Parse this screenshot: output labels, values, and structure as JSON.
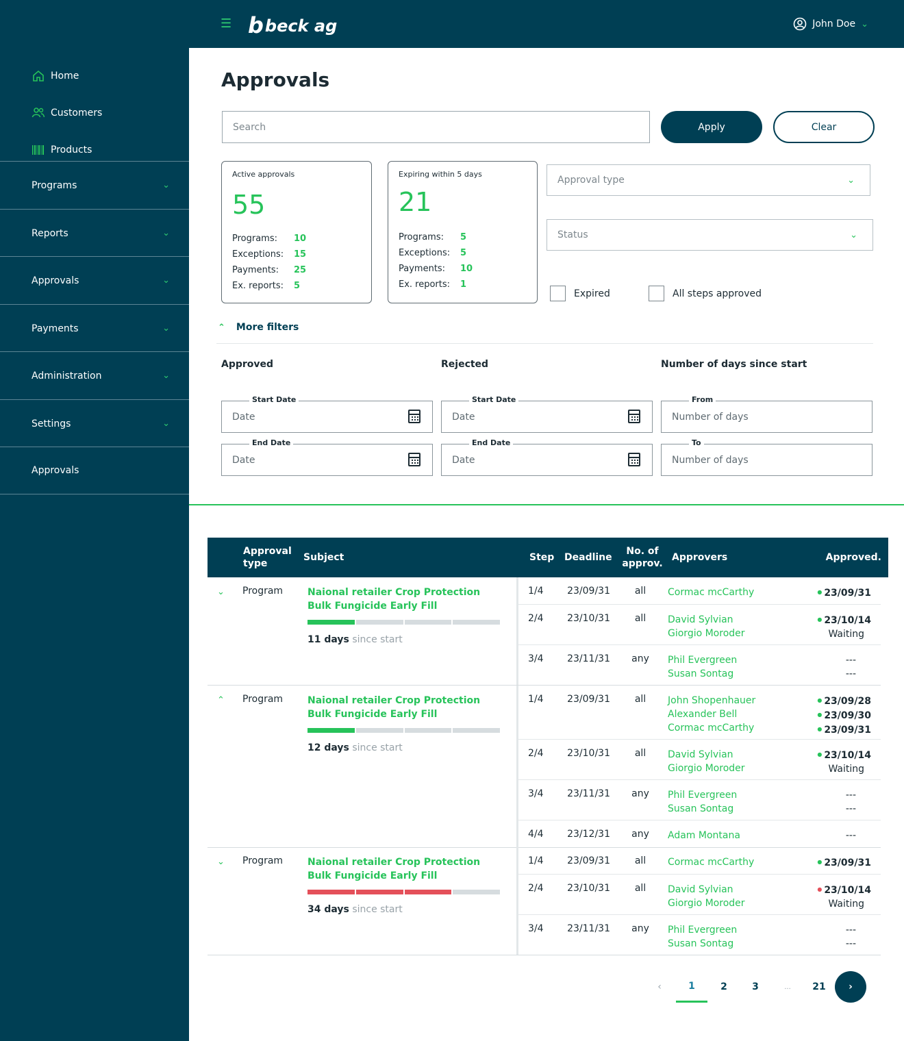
{
  "app": {
    "logo_mark": "b",
    "logo_text": "beck ag",
    "user_name": "John Doe"
  },
  "sidebar": {
    "links": [
      {
        "label": "Home",
        "icon": "home-icon"
      },
      {
        "label": "Customers",
        "icon": "users-icon"
      },
      {
        "label": "Products",
        "icon": "barcode-icon"
      }
    ],
    "sections": [
      {
        "label": "Programs",
        "expandable": true
      },
      {
        "label": "Reports",
        "expandable": true
      },
      {
        "label": "Approvals",
        "expandable": true
      },
      {
        "label": "Payments",
        "expandable": true
      },
      {
        "label": "Administration",
        "expandable": true
      },
      {
        "label": "Settings",
        "expandable": true
      },
      {
        "label": "Approvals",
        "expandable": false
      }
    ]
  },
  "page": {
    "title": "Approvals"
  },
  "search": {
    "placeholder": "Search",
    "value": "",
    "apply_label": "Apply",
    "clear_label": "Clear"
  },
  "summary": {
    "active": {
      "label": "Active approvals",
      "total": "55",
      "rows": [
        {
          "k": "Programs:",
          "v": "10"
        },
        {
          "k": "Exceptions:",
          "v": "15"
        },
        {
          "k": "Payments:",
          "v": "25"
        },
        {
          "k": "Ex. reports:",
          "v": "5"
        }
      ]
    },
    "expiring": {
      "label": "Expiring within 5 days",
      "total": "21",
      "rows": [
        {
          "k": "Programs:",
          "v": "5"
        },
        {
          "k": "Exceptions:",
          "v": "5"
        },
        {
          "k": "Payments:",
          "v": "10"
        },
        {
          "k": "Ex. reports:",
          "v": "1"
        }
      ]
    }
  },
  "filters": {
    "approval_type_placeholder": "Approval type",
    "status_placeholder": "Status",
    "expired_label": "Expired",
    "all_steps_label": "All steps approved",
    "more_filters_label": "More filters",
    "approved_title": "Approved",
    "rejected_title": "Rejected",
    "days_title": "Number of days since start",
    "start_date_legend": "Start Date",
    "end_date_legend": "End Date",
    "from_legend": "From",
    "to_legend": "To",
    "date_placeholder": "Date",
    "days_placeholder": "Number of days"
  },
  "table": {
    "headers": {
      "approval_type": "Approval type",
      "subject": "Subject",
      "step": "Step",
      "deadline": "Deadline",
      "no_approv": "No. of approv.",
      "approvers": "Approvers",
      "approved": "Approved."
    },
    "groups": [
      {
        "expanded": false,
        "type": "Program",
        "subject": "Naional retailer Crop Protection Bulk Fungicide Early Fill",
        "progress_segments": [
          "green",
          "gray",
          "gray",
          "gray"
        ],
        "days": "11 days",
        "days_suffix": "since start",
        "steps": [
          {
            "num": "1/4",
            "deadline": "23/09/31",
            "no": "all",
            "approvers": [
              "Cormac mcCarthy"
            ],
            "dates": [
              {
                "text": "23/09/31",
                "status": "green"
              }
            ]
          },
          {
            "num": "2/4",
            "deadline": "23/10/31",
            "no": "all",
            "approvers": [
              "David Sylvian",
              "Giorgio Moroder"
            ],
            "dates": [
              {
                "text": "23/10/14",
                "status": "green"
              },
              {
                "text": "Waiting",
                "status": "wait"
              }
            ]
          },
          {
            "num": "3/4",
            "deadline": "23/11/31",
            "no": "any",
            "approvers": [
              "Phil Evergreen",
              "Susan Sontag"
            ],
            "dates": [
              {
                "text": "---",
                "status": "dash"
              },
              {
                "text": "---",
                "status": "dash"
              }
            ]
          }
        ]
      },
      {
        "expanded": true,
        "type": "Program",
        "subject": "Naional retailer Crop Protection Bulk Fungicide Early Fill",
        "progress_segments": [
          "green",
          "gray",
          "gray",
          "gray"
        ],
        "days": "12 days",
        "days_suffix": "since start",
        "steps": [
          {
            "num": "1/4",
            "deadline": "23/09/31",
            "no": "all",
            "approvers": [
              "John Shopenhauer",
              "Alexander Bell",
              "Cormac mcCarthy"
            ],
            "dates": [
              {
                "text": "23/09/28",
                "status": "green"
              },
              {
                "text": "23/09/30",
                "status": "green"
              },
              {
                "text": "23/09/31",
                "status": "green"
              }
            ]
          },
          {
            "num": "2/4",
            "deadline": "23/10/31",
            "no": "all",
            "approvers": [
              "David Sylvian",
              "Giorgio Moroder"
            ],
            "dates": [
              {
                "text": "23/10/14",
                "status": "green"
              },
              {
                "text": "Waiting",
                "status": "wait"
              }
            ]
          },
          {
            "num": "3/4",
            "deadline": "23/11/31",
            "no": "any",
            "approvers": [
              "Phil Evergreen",
              "Susan Sontag"
            ],
            "dates": [
              {
                "text": "---",
                "status": "dash"
              },
              {
                "text": "---",
                "status": "dash"
              }
            ]
          },
          {
            "num": "4/4",
            "deadline": "23/12/31",
            "no": "any",
            "approvers": [
              "Adam Montana"
            ],
            "dates": [
              {
                "text": "---",
                "status": "dash"
              }
            ]
          }
        ]
      },
      {
        "expanded": false,
        "type": "Program",
        "subject": "Naional retailer Crop Protection Bulk Fungicide Early Fill",
        "progress_segments": [
          "red",
          "red",
          "red",
          "gray"
        ],
        "days": "34 days",
        "days_suffix": "since start",
        "steps": [
          {
            "num": "1/4",
            "deadline": "23/09/31",
            "no": "all",
            "approvers": [
              "Cormac mcCarthy"
            ],
            "dates": [
              {
                "text": "23/09/31",
                "status": "green"
              }
            ]
          },
          {
            "num": "2/4",
            "deadline": "23/10/31",
            "no": "all",
            "approvers": [
              "David Sylvian",
              "Giorgio Moroder"
            ],
            "dates": [
              {
                "text": "23/10/14",
                "status": "red"
              },
              {
                "text": "Waiting",
                "status": "wait"
              }
            ]
          },
          {
            "num": "3/4",
            "deadline": "23/11/31",
            "no": "any",
            "approvers": [
              "Phil Evergreen",
              "Susan Sontag"
            ],
            "dates": [
              {
                "text": "---",
                "status": "dash"
              },
              {
                "text": "---",
                "status": "dash"
              }
            ]
          }
        ]
      }
    ]
  },
  "pagination": {
    "pages": [
      "1",
      "2",
      "3",
      "...",
      "21"
    ],
    "current": "1",
    "prev_icon": "chevron-left-icon",
    "next_icon": "chevron-right-icon"
  },
  "colors": {
    "navy": "#003f54",
    "green": "#27c35a",
    "red": "#e4505a"
  }
}
